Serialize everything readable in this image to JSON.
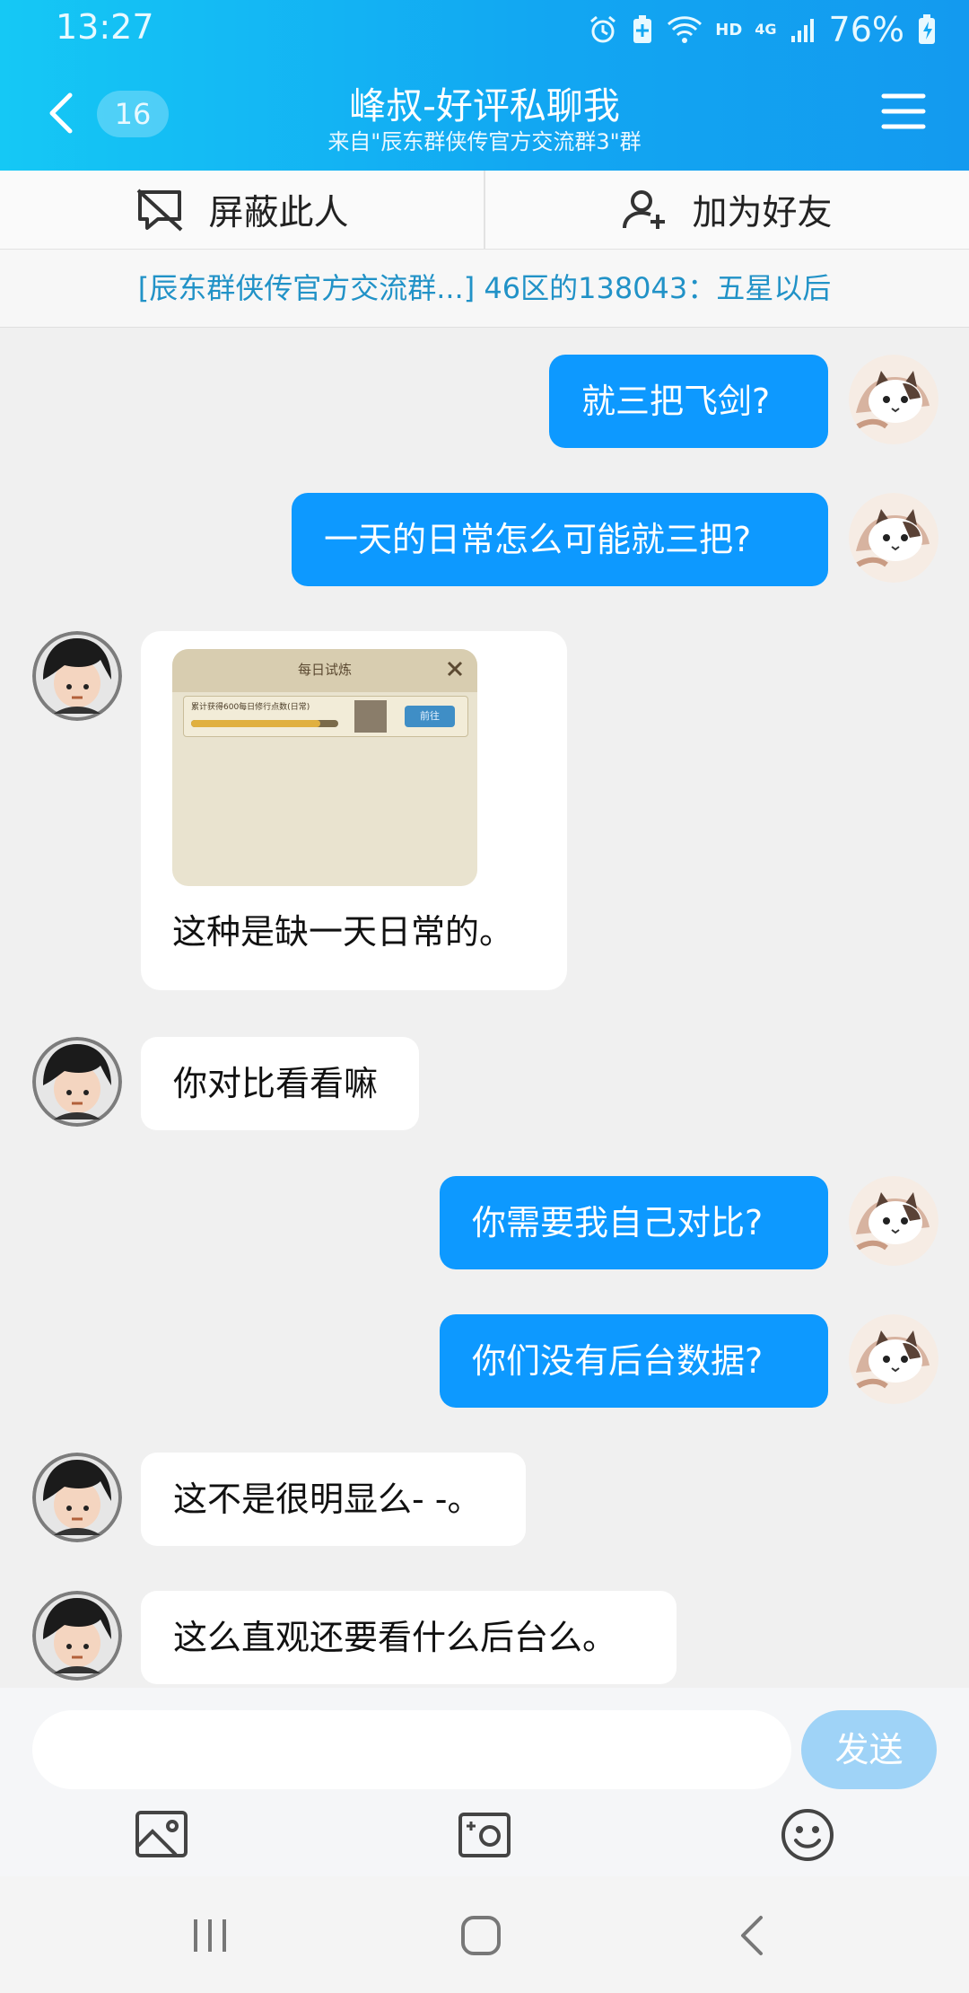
{
  "status_bar": {
    "time": "13:27",
    "network_hd": "HD",
    "network_type": "4G",
    "battery": "76%"
  },
  "header": {
    "unread_count": "16",
    "title": "峰叔-好评私聊我",
    "subtitle": "来自\"辰东群侠传官方交流群3\"群"
  },
  "actions": {
    "block_label": "屏蔽此人",
    "add_friend_label": "加为好友"
  },
  "notice": "[辰东群侠传官方交流群...] 46区的138043：五星以后",
  "messages": [
    {
      "dir": "out",
      "text": "就三把飞剑?"
    },
    {
      "dir": "out",
      "text": "一天的日常怎么可能就三把?"
    },
    {
      "dir": "in",
      "type": "image",
      "image_title": "每日试炼",
      "image_task": "累计获得600每日修行点数(日常)",
      "image_button": "前往",
      "text": "这种是缺一天日常的。"
    },
    {
      "dir": "in",
      "text": "你对比看看嘛"
    },
    {
      "dir": "out",
      "text": "你需要我自己对比?"
    },
    {
      "dir": "out",
      "text": "你们没有后台数据?"
    },
    {
      "dir": "in",
      "text": "这不是很明显么- -。"
    },
    {
      "dir": "in",
      "text": "这么直观还要看什么后台么。"
    }
  ],
  "composer": {
    "input_value": "",
    "send_label": "发送"
  },
  "colors": {
    "header_start": "#15c8f5",
    "header_end": "#139aef",
    "bubble_out": "#0d99ff",
    "notice_text": "#2192c7",
    "send_disabled": "#9fd3f7"
  }
}
